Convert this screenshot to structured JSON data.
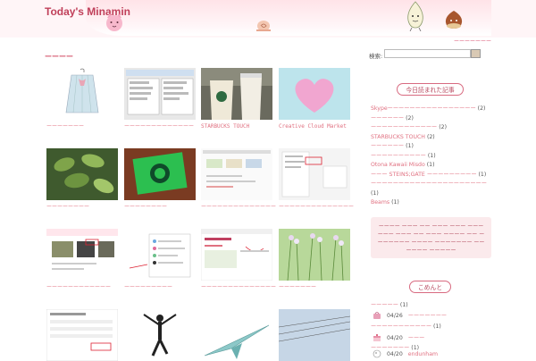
{
  "header": {
    "site_title": "Today's Minamin",
    "subnav_link": "ーーーーーーー"
  },
  "main": {
    "section_title": "ーーーー",
    "tiles": [
      {
        "caption": "ーーーーーーー"
      },
      {
        "caption": "ーーーーーーーーーーーーー"
      },
      {
        "caption": "STARBUCKS TOUCH"
      },
      {
        "caption": "Creative Cloud Market"
      },
      {
        "caption": "ーーーーーーーー"
      },
      {
        "caption": "ーーーーーーーー"
      },
      {
        "caption": "ーーーーーーーーーーーーーー"
      },
      {
        "caption": "ーーーーーーーーーーーーーー"
      },
      {
        "caption": "ーーーーーーーーーーーー"
      },
      {
        "caption": "ーーーーーーーーー"
      },
      {
        "caption": "ーーーーーーーーーーーーーー"
      },
      {
        "caption": "ーーーーーーー"
      },
      {
        "caption": ""
      },
      {
        "caption": ""
      },
      {
        "caption": ""
      },
      {
        "caption": ""
      }
    ]
  },
  "sidebar": {
    "search_label": "検索:",
    "search_value": "",
    "popular_title": "今日読まれた記事",
    "popular_items": [
      {
        "label": "Skypeーーーーーーーーーーーーーーーー",
        "count": "(2)"
      },
      {
        "label": "ーーーーーー",
        "count": "(2)"
      },
      {
        "label": "ーーーーーーーーーーーー",
        "count": "(2)"
      },
      {
        "label": "STARBUCKS TOUCH",
        "count": "(2)"
      },
      {
        "label": "ーーーーーー",
        "count": "(1)"
      },
      {
        "label": "ーーーーーーーーーー",
        "count": "(1)"
      },
      {
        "label": "Otona Kawaii Misdo",
        "count": "(1)"
      },
      {
        "label": "ーーー STEINS;GATE ーーーーーーーーー",
        "count": "(1)"
      },
      {
        "label": "ーーーーーーーーーーーーーーーーーーーーー",
        "count": "(1)"
      },
      {
        "label": "Beams",
        "count": "(1)"
      }
    ],
    "tag_cloud_text": "ーーーー ーーー ーー ーーー ーーー ーーーーーー ーーー ーー ーーー ーーーー ーー ーーーーーーー ーーーー ーーーーーーー ーー ーーーー ーーーーー",
    "comments_title": "こめんと",
    "comments": [
      {
        "post": "ーーーーー",
        "count": "(1)"
      },
      {
        "date": "04/26",
        "author": "ーーーーーーー"
      },
      {
        "post": "ーーーーーーーーーーー",
        "count": "(1)"
      },
      {
        "date": "04/20",
        "author": "ーーー"
      },
      {
        "post": "ーーーーーーー",
        "count": "(1)"
      },
      {
        "date": "04/20",
        "author": "endunham"
      }
    ]
  },
  "colors": {
    "accent": "#d24a62",
    "link": "#e07080",
    "header_bg": "#ffe3e8"
  }
}
